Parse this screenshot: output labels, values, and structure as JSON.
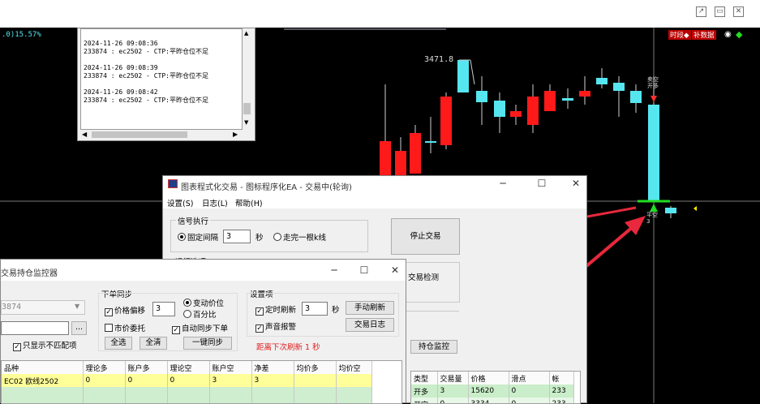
{
  "toolbar": {
    "icons": [
      "external-icon",
      "minimize-icon",
      "close-icon"
    ]
  },
  "chart": {
    "pct_label": ".0)15.57%",
    "price_label": "3471.8",
    "badge_time": "时段◆",
    "badge_data": "补数据",
    "annotation_top": "卖空\n开多",
    "annotation_bottom": "平空\n3",
    "colors": {
      "up": "#ff1a1a",
      "down": "#55e6f0",
      "signal": "#22dd22",
      "arrow": "#e8283c"
    }
  },
  "log": {
    "entries": [
      {
        "time": "2024-11-26 09:08:36",
        "msg": "233874 : ec2502 - CTP:平昨仓位不足"
      },
      {
        "time": "2024-11-26 09:08:39",
        "msg": "233874 : ec2502 - CTP:平昨仓位不足"
      },
      {
        "time": "2024-11-26 09:08:42",
        "msg": "233874 : ec2502 - CTP:平昨仓位不足"
      }
    ]
  },
  "ea": {
    "title": "图表程式化交易 - 图标程序化EA - 交易中(轮询)",
    "menu": [
      "设置(S)",
      "日志(L)",
      "帮助(H)"
    ],
    "signal_group": "信号执行",
    "fixed_interval": "固定间隔",
    "interval_value": "3",
    "sec": "秒",
    "after_bar": "走完一根k线",
    "stop_button": "停止交易",
    "run_group": "运行选项",
    "trade_check": "交易检测",
    "position_monitor": "持仓监控",
    "table_headers": [
      "类型",
      "交易量",
      "价格",
      "滑点",
      "帐"
    ],
    "table_rows": [
      [
        "开多",
        "3",
        "15620",
        "0",
        "233"
      ],
      [
        "开空",
        "0",
        "3334",
        "0",
        "233"
      ]
    ]
  },
  "monitor": {
    "title": "交易持仓监控器",
    "account": "3874",
    "only_unmatched": "只显示不匹配项",
    "more_btn": "...",
    "order_sync": "下单同步",
    "price_offset": "价格偏移",
    "offset_value": "3",
    "change_price": "变动价位",
    "percent": "百分比",
    "market_order": "市价委托",
    "auto_sync": "自动同步下单",
    "select_all": "全选",
    "clear_all": "全清",
    "one_key_sync": "一键同步",
    "settings": "设置项",
    "timed_refresh": "定时刷新",
    "refresh_value": "3",
    "sec": "秒",
    "manual_refresh": "手动刷新",
    "sound_alarm": "声音报警",
    "trade_log": "交易日志",
    "countdown": "距离下次刷新 1 秒",
    "table_headers": [
      "品种",
      "理论多",
      "账户多",
      "理论空",
      "账户空",
      "净差",
      "均价多",
      "均价空"
    ],
    "table_rows": [
      [
        "EC02 欧线2502",
        "0",
        "0",
        "0",
        "3",
        "3",
        "",
        ""
      ]
    ]
  }
}
